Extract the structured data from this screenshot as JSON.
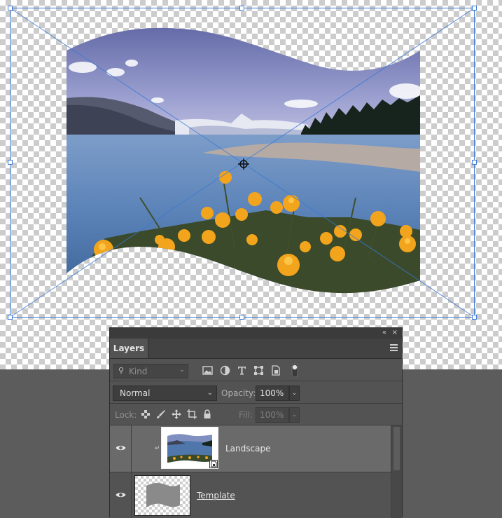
{
  "panel": {
    "tab_label": "Layers",
    "collapse_glyph": "«",
    "close_glyph": "×",
    "filter": {
      "search_glyph": "⚲",
      "kind_label": "Kind",
      "chevron": "⌄"
    },
    "blend_mode": "Normal",
    "opacity_label": "Opacity:",
    "opacity_value": "100%",
    "lock_label": "Lock:",
    "fill_label": "Fill:",
    "fill_value": "100%",
    "dropdown_glyph": "⌄"
  },
  "layers": [
    {
      "name": "Landscape",
      "clip_glyph": "↵"
    },
    {
      "name": "Template"
    }
  ],
  "colors": {
    "accent": "#3a78d4",
    "panel_bg": "#535353",
    "selected_row": "#6a6a6a",
    "pasteboard": "#5c5c5c"
  }
}
